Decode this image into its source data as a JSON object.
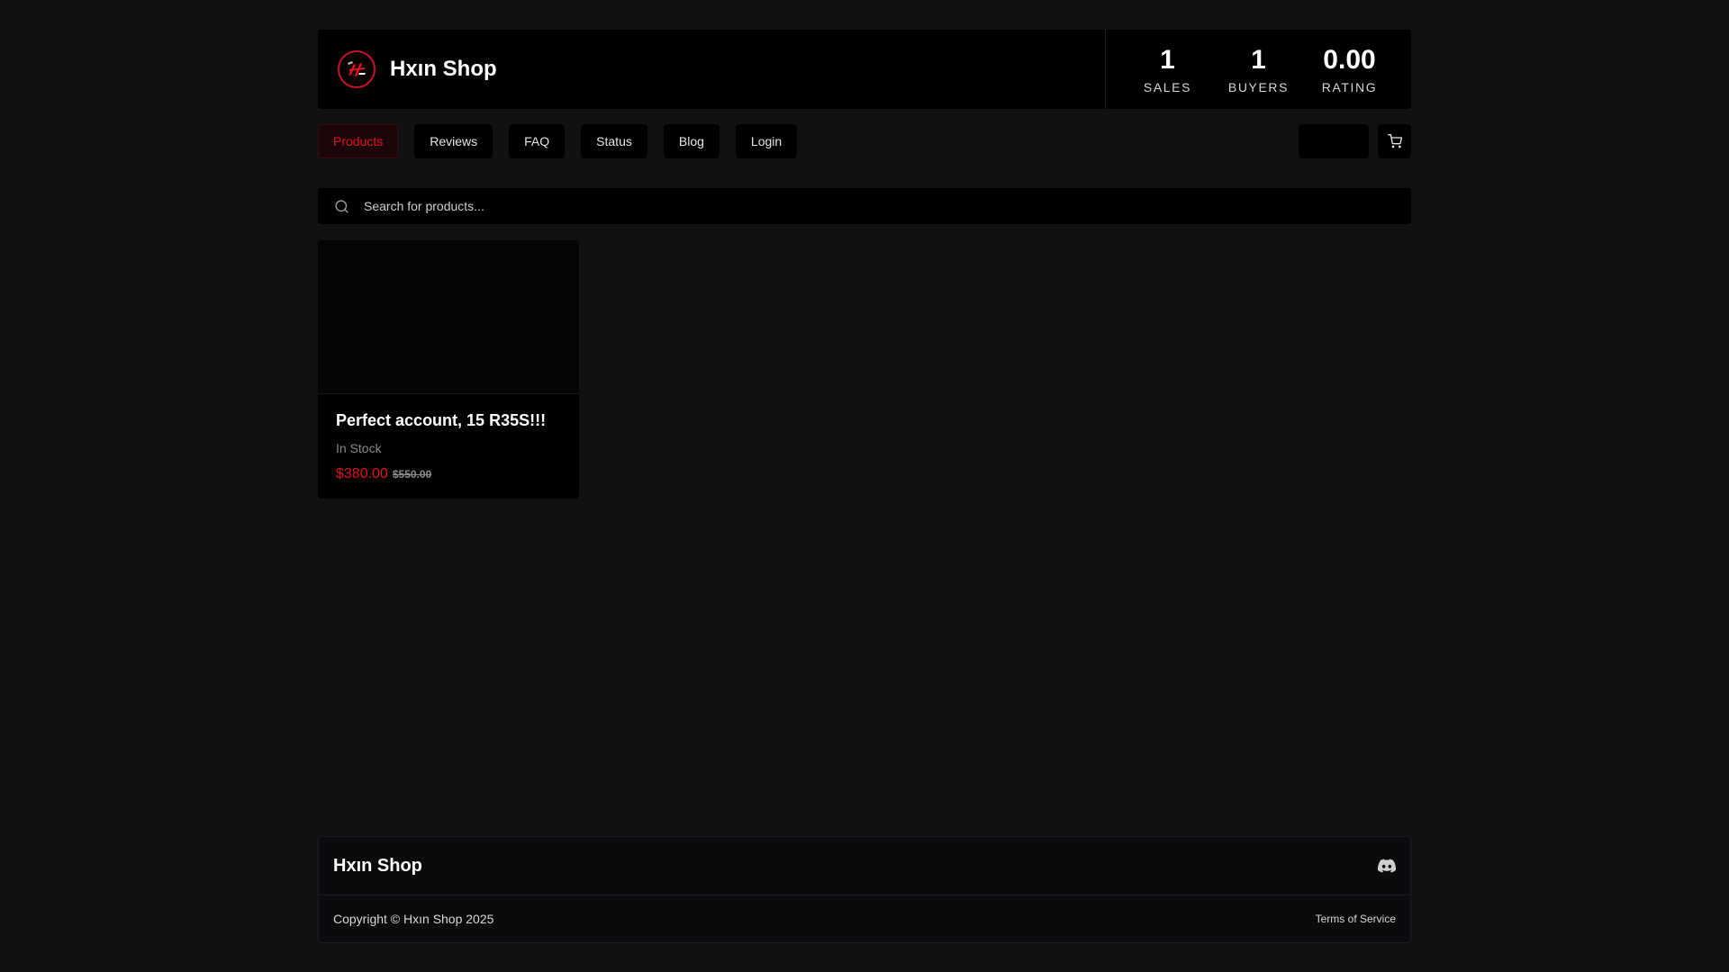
{
  "brand": {
    "name": "Hxın Shop"
  },
  "stats": [
    {
      "value": "1",
      "label": "SALES"
    },
    {
      "value": "1",
      "label": "BUYERS"
    },
    {
      "value": "0.00",
      "label": "RATING"
    }
  ],
  "nav": {
    "items": [
      {
        "label": "Products",
        "active": true
      },
      {
        "label": "Reviews"
      },
      {
        "label": "FAQ"
      },
      {
        "label": "Status"
      },
      {
        "label": "Blog"
      },
      {
        "label": "Login"
      }
    ]
  },
  "search": {
    "placeholder": "Search for products..."
  },
  "products": [
    {
      "title": "Perfect account, 15 R35S!!!",
      "stock": "In Stock",
      "price": "$380.00",
      "original_price": "$550.00"
    }
  ],
  "footer": {
    "brand": "Hxın Shop",
    "copyright": "Copyright © Hxın Shop 2025",
    "tos": "Terms of Service"
  },
  "colors": {
    "accent": "#e0151f",
    "background": "#111113",
    "surface": "#000000"
  },
  "icons": {
    "logo": "brand-logo",
    "search": "search-icon",
    "cart": "cart-icon",
    "discord": "discord-icon"
  }
}
